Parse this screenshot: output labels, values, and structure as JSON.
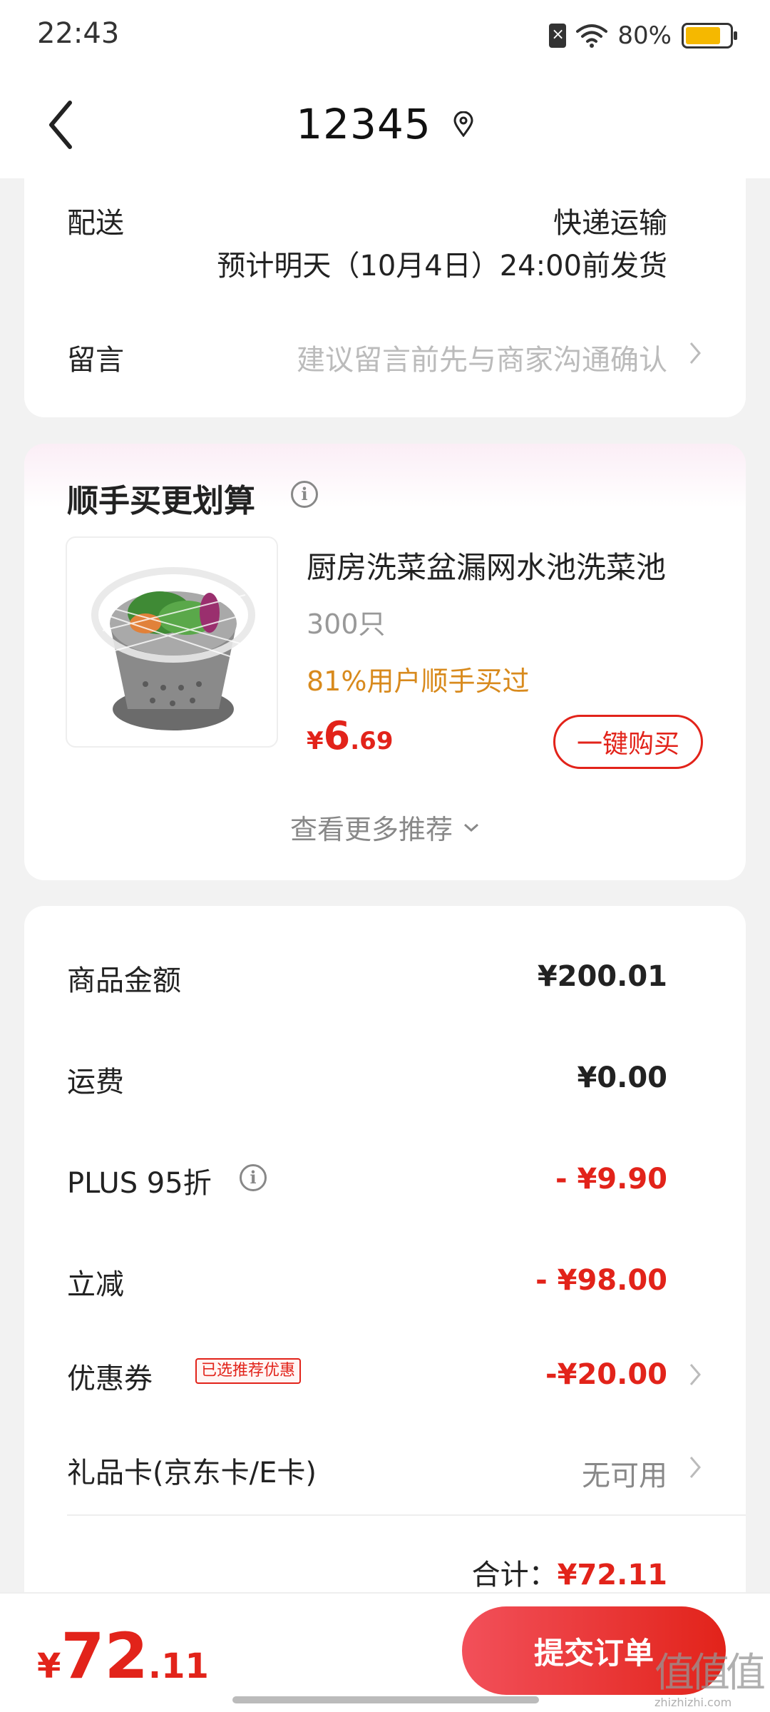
{
  "status_bar": {
    "time": "22:43",
    "battery_text": "80%",
    "battery_level": 0.8
  },
  "header": {
    "title": "12345"
  },
  "delivery": {
    "label": "配送",
    "method": "快递运输",
    "estimate": "预计明天（10月4日）24:00前发货"
  },
  "message": {
    "label": "留言",
    "placeholder": "建议留言前先与商家沟通确认"
  },
  "addon": {
    "title": "顺手买更划算",
    "product": {
      "name": "厨房洗菜盆漏网水池洗菜池",
      "spec": "300只",
      "hint": "81%用户顺手买过",
      "price_currency": "¥",
      "price_int": "6",
      "price_dec": ".69",
      "buy_label": "一键购买"
    },
    "more_label": "查看更多推荐"
  },
  "summary": {
    "goods_label": "商品金额",
    "goods_value": "¥200.01",
    "shipping_label": "运费",
    "shipping_value": "¥0.00",
    "plus_label": "PLUS 95折",
    "plus_value": "- ¥9.90",
    "instant_label": "立减",
    "instant_value": "- ¥98.00",
    "coupon_label": "优惠券",
    "coupon_tag": "已选推荐优惠",
    "coupon_value": "-¥20.00",
    "giftcard_label": "礼品卡(京东卡/E卡)",
    "giftcard_value": "无可用",
    "total_label": "合计：",
    "total_value": "¥72.11"
  },
  "bottom": {
    "price_currency": "¥",
    "price_int": "72",
    "price_dec": ".11",
    "submit_label": "提交订单"
  },
  "watermark": {
    "chars": "值值值",
    "site": "zhizhizhi.com"
  },
  "colors": {
    "accent_red": "#e2231a",
    "hint_orange": "#d88a1d"
  }
}
